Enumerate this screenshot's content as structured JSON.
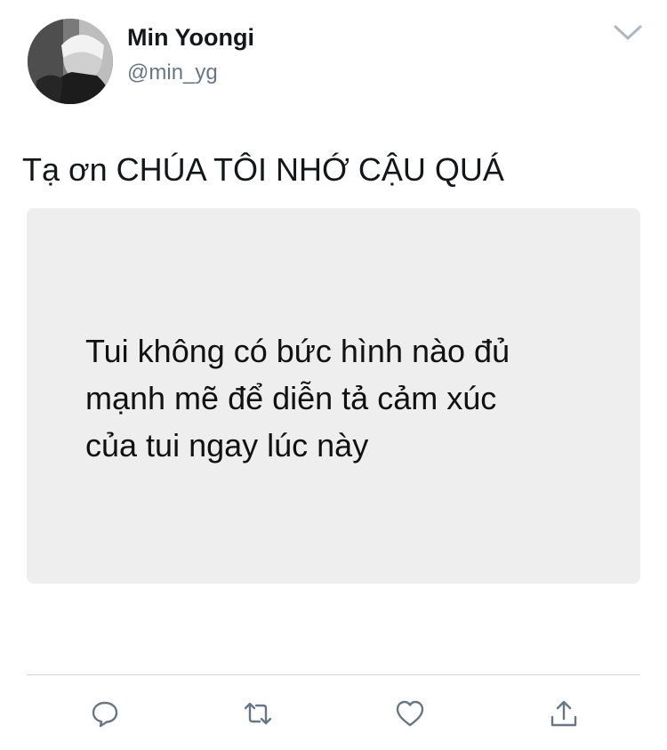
{
  "user": {
    "display_name": "Min Yoongi",
    "handle": "@min_yg",
    "avatar_icon": "profile-photo"
  },
  "tweet": {
    "text": "Tạ ơn CHÚA TÔI NHỚ CẬU QUÁ",
    "media_text": "Tui không có bức hình nào đủ\nmạnh mẽ để diễn tả cảm xúc\ncủa tui ngay lúc này"
  },
  "actions": {
    "reply_icon": "speech-bubble-icon",
    "retweet_icon": "retweet-arrows-icon",
    "like_icon": "heart-icon",
    "share_icon": "share-upload-icon"
  },
  "colors": {
    "text": "#14171a",
    "handle": "#657786",
    "icon": "#657786",
    "media_bg": "#eeeeee"
  }
}
